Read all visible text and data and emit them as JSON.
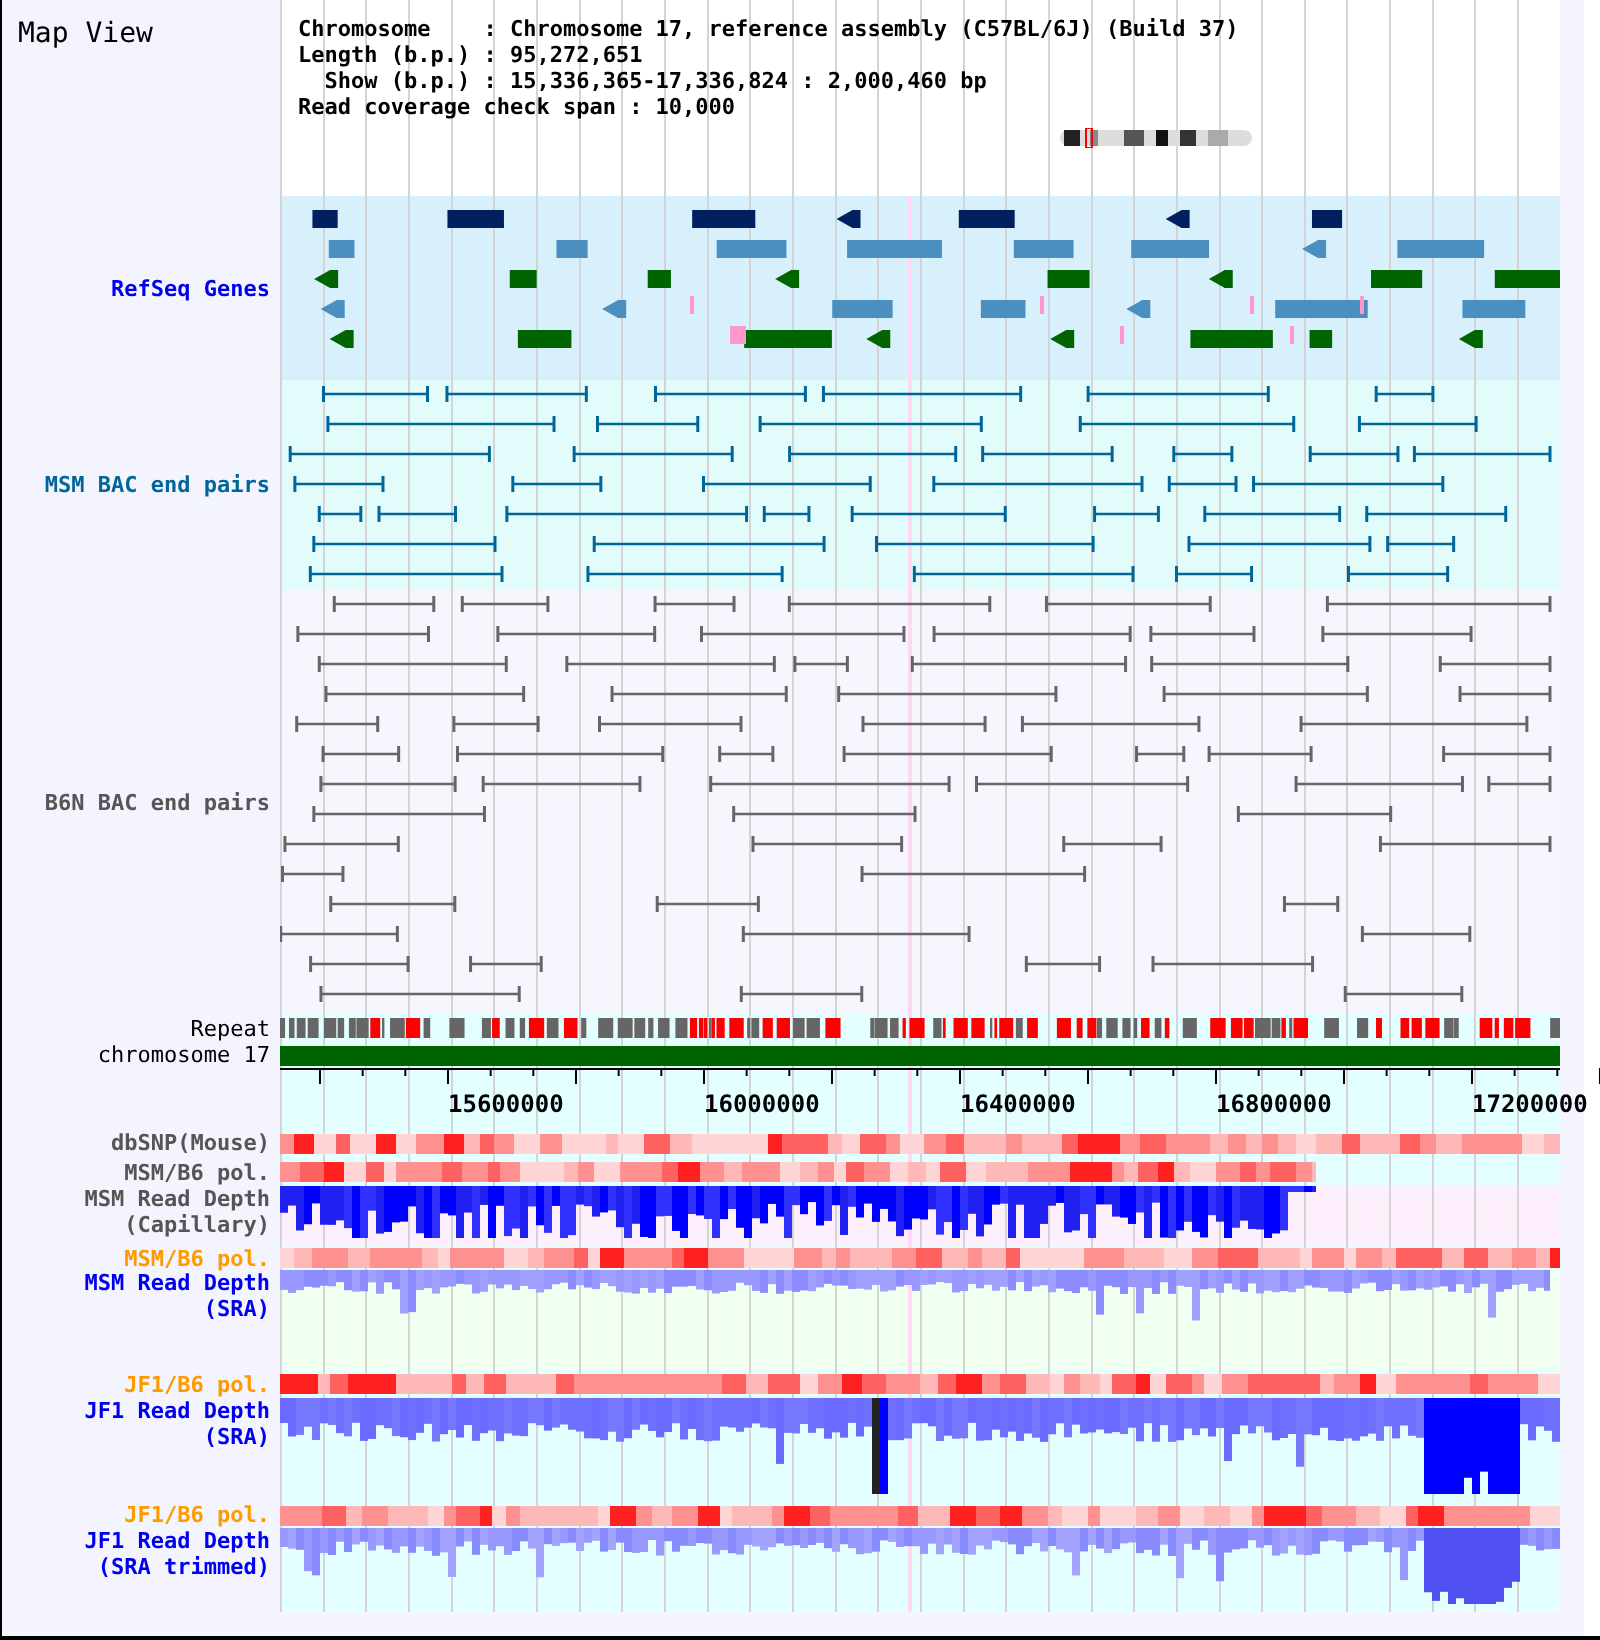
{
  "title": "Map View",
  "info_lines": [
    "Chromosome    : Chromosome 17, reference assembly (C57BL/6J) (Build 37)",
    "Length (b.p.) : 95,272,651",
    "  Show (b.p.) : 15,336,365-17,336,824 : 2,000,460 bp",
    "Read coverage check span : 10,000"
  ],
  "tracks": [
    {
      "kind": "genes",
      "label": [
        "RefSeq Genes"
      ],
      "color": "#0000ee"
    },
    {
      "kind": "pairs",
      "label": [
        "MSM BAC end pairs"
      ],
      "color": "#006699"
    },
    {
      "kind": "pairs",
      "label": [
        "B6N BAC end pairs"
      ],
      "color": "#555555"
    },
    {
      "kind": "repeat",
      "label": [
        "Repeat"
      ],
      "color": "#000000"
    },
    {
      "kind": "chromosome",
      "label": [
        "chromosome 17"
      ],
      "color": "#000000"
    },
    {
      "kind": "axis",
      "ticks": [
        "15600000",
        "16000000",
        "16400000",
        "16800000",
        "17200000"
      ]
    },
    {
      "kind": "heat",
      "label": [
        "dbSNP(Mouse)"
      ],
      "color": "#555555"
    },
    {
      "kind": "heat",
      "label": [
        "MSM/B6 pol."
      ],
      "color": "#555555"
    },
    {
      "kind": "depth",
      "label": [
        "MSM Read Depth",
        "(Capillary)"
      ],
      "color": "#555555"
    },
    {
      "kind": "heat",
      "label": [
        "MSM/B6 pol."
      ],
      "color": "#ff9900"
    },
    {
      "kind": "depth",
      "label": [
        "MSM Read Depth",
        "(SRA)"
      ],
      "color": "#0000ee"
    },
    {
      "kind": "heat",
      "label": [
        "JF1/B6 pol."
      ],
      "color": "#ff9900"
    },
    {
      "kind": "depth",
      "label": [
        "JF1 Read Depth",
        "(SRA)"
      ],
      "color": "#0000ee"
    },
    {
      "kind": "heat",
      "label": [
        "JF1/B6 pol."
      ],
      "color": "#ff9900"
    },
    {
      "kind": "depth",
      "label": [
        "JF1 Read Depth",
        "(SRA trimmed)"
      ],
      "color": "#0000ee"
    }
  ]
}
